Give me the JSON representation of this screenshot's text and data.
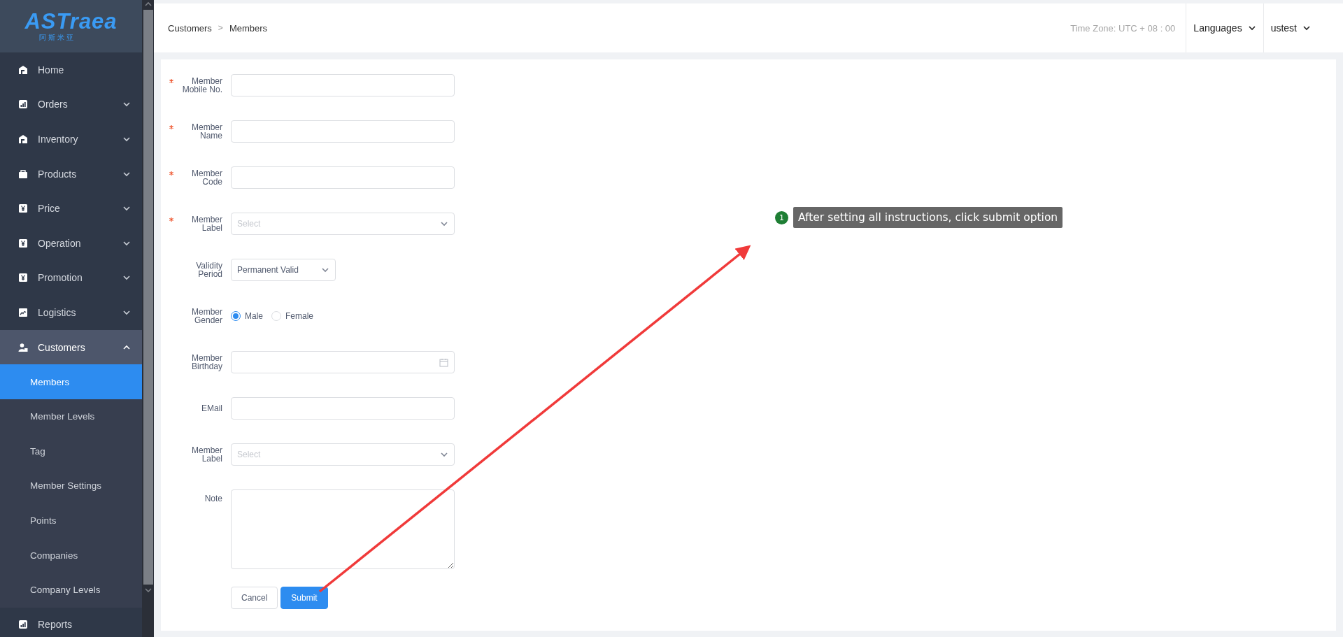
{
  "logo": {
    "wordmark": "ASTraea",
    "tagline": "阿斯米亚"
  },
  "sidebar": {
    "items": [
      {
        "label": "Home",
        "expandable": false,
        "expanded": false
      },
      {
        "label": "Orders",
        "expandable": true,
        "expanded": false
      },
      {
        "label": "Inventory",
        "expandable": true,
        "expanded": false
      },
      {
        "label": "Products",
        "expandable": true,
        "expanded": false
      },
      {
        "label": "Price",
        "expandable": true,
        "expanded": false
      },
      {
        "label": "Operation",
        "expandable": true,
        "expanded": false
      },
      {
        "label": "Promotion",
        "expandable": true,
        "expanded": false
      },
      {
        "label": "Logistics",
        "expandable": true,
        "expanded": false
      },
      {
        "label": "Customers",
        "expandable": true,
        "expanded": true,
        "children": [
          {
            "label": "Members",
            "selected": true
          },
          {
            "label": "Member Levels",
            "selected": false
          },
          {
            "label": "Tag",
            "selected": false
          },
          {
            "label": "Member Settings",
            "selected": false
          },
          {
            "label": "Points",
            "selected": false
          },
          {
            "label": "Companies",
            "selected": false
          },
          {
            "label": "Company Levels",
            "selected": false
          }
        ]
      },
      {
        "label": "Reports",
        "expandable": false,
        "expanded": false
      }
    ]
  },
  "header": {
    "breadcrumb": [
      "Customers",
      "Members"
    ],
    "separator": ">",
    "time_zone": "Time Zone: UTC + 08 : 00",
    "menus": [
      "Languages",
      "ustest"
    ]
  },
  "form": {
    "fields": [
      {
        "kind": "text",
        "label": "Member Mobile No.",
        "required": true
      },
      {
        "kind": "text",
        "label": "Member Name",
        "required": true
      },
      {
        "kind": "text",
        "label": "Member Code",
        "required": true
      },
      {
        "kind": "select",
        "label": "Member Label",
        "required": true,
        "placeholder": "Select"
      },
      {
        "kind": "dropdown",
        "label": "Validity Period",
        "required": false,
        "value": "Permanent Valid"
      },
      {
        "kind": "radio",
        "label": "Member Gender",
        "required": false,
        "options": [
          {
            "label": "Male",
            "selected": true
          },
          {
            "label": "Female",
            "selected": false
          }
        ]
      },
      {
        "kind": "date",
        "label": "Member Birthday",
        "required": false
      },
      {
        "kind": "text",
        "label": "EMail",
        "required": false
      },
      {
        "kind": "select",
        "label": "Member Label",
        "required": false,
        "placeholder": "Select"
      },
      {
        "kind": "textarea",
        "label": "Note",
        "required": false
      }
    ],
    "buttons": [
      {
        "kind": "secondary",
        "label": "Cancel"
      },
      {
        "kind": "primary",
        "label": "Submit"
      }
    ]
  },
  "annotation": {
    "step": "1",
    "text": "After setting all instructions, click submit option"
  }
}
